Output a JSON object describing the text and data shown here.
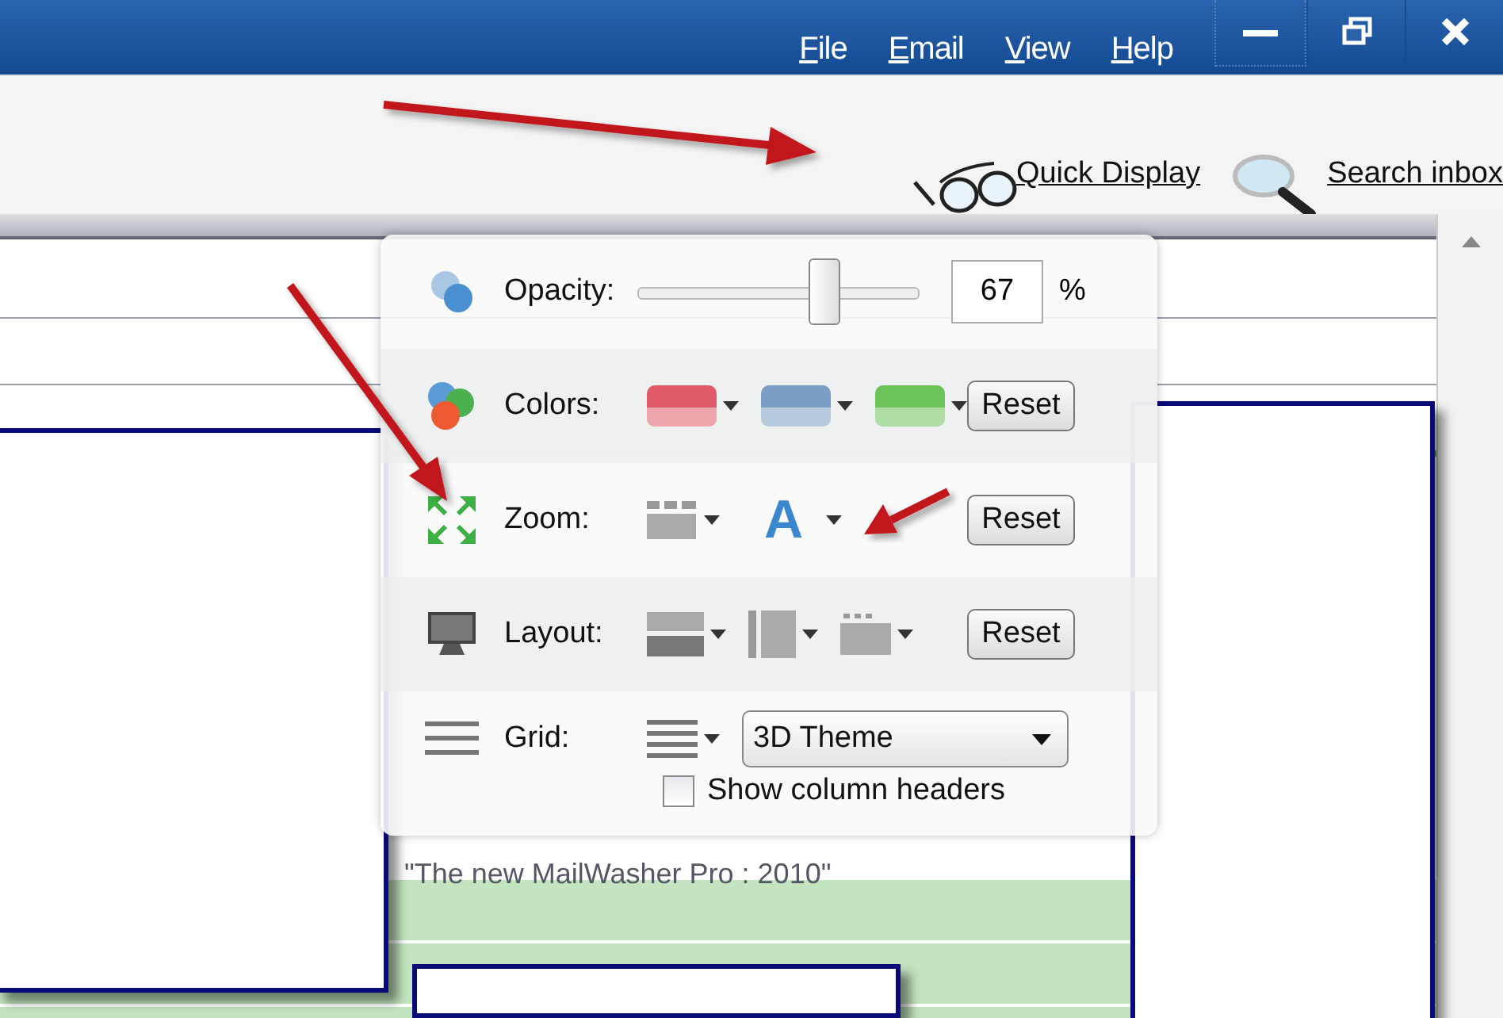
{
  "title_bar": {
    "menu": [
      {
        "label": "File"
      },
      {
        "label": "Email"
      },
      {
        "label": "View"
      },
      {
        "label": "Help"
      }
    ]
  },
  "toolbar": {
    "links": [
      {
        "kind": "glasses",
        "label": "Quick Display"
      },
      {
        "kind": "search",
        "label": "Search inbox"
      }
    ]
  },
  "message_list": {
    "rows": [
      {
        "kind": "plain",
        "text": ""
      },
      {
        "kind": "plain",
        "text": ""
      },
      {
        "kind": "plain",
        "text": ""
      },
      {
        "kind": "spacer",
        "text": ""
      },
      {
        "kind": "green",
        "text": "\"The new MailWasher Pro : 2010\""
      },
      {
        "kind": "green",
        "text": ""
      },
      {
        "kind": "green",
        "text": ""
      }
    ]
  },
  "quick_display": {
    "opacity": {
      "label": "Opacity:",
      "level": 0.67,
      "value": "67",
      "unit": "%"
    },
    "colors": {
      "label": "Colors:",
      "swatches": [
        {
          "color": "#e05a6a"
        },
        {
          "color": "#7b9fc4"
        },
        {
          "color": "#6cc35a"
        }
      ],
      "reset": "Reset"
    },
    "zoom": {
      "label": "Zoom:",
      "font_glyph": "A",
      "reset": "Reset"
    },
    "layout": {
      "label": "Layout:",
      "reset": "Reset"
    },
    "grid": {
      "label": "Grid:",
      "theme": "3D Theme",
      "show_column_headers": {
        "label": "Show column headers",
        "checked": false
      }
    }
  }
}
